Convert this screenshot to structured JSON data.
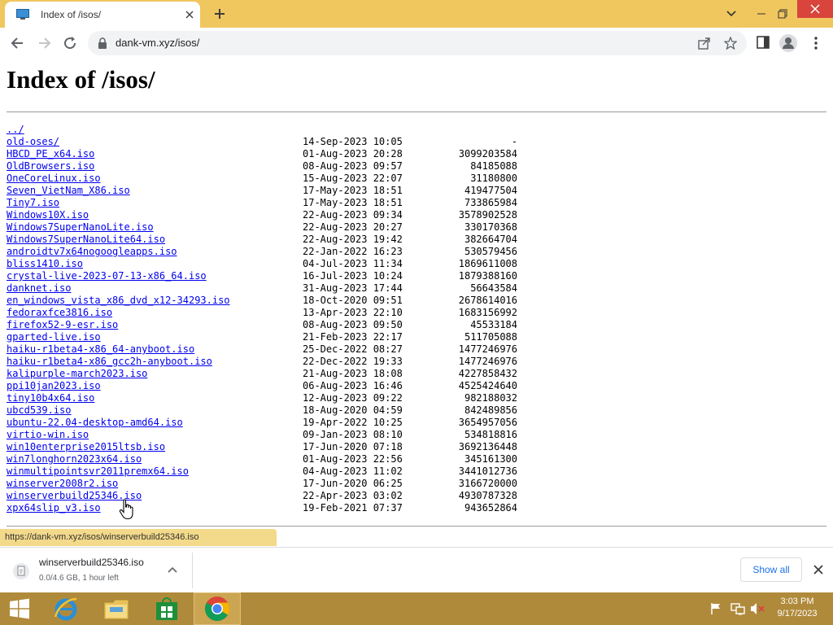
{
  "browser": {
    "tab_title": "Index of /isos/",
    "url": "dank-vm.xyz/isos/",
    "status_url": "https://dank-vm.xyz/isos/winserverbuild25346.iso"
  },
  "page": {
    "title": "Index of /isos/",
    "parent_link": "../",
    "entries": [
      {
        "name": "old-oses/",
        "date": "14-Sep-2023 10:05",
        "size": "-"
      },
      {
        "name": "HBCD_PE_x64.iso",
        "date": "01-Aug-2023 20:28",
        "size": "3099203584"
      },
      {
        "name": "OldBrowsers.iso",
        "date": "08-Aug-2023 09:57",
        "size": "84185088"
      },
      {
        "name": "OneCoreLinux.iso",
        "date": "15-Aug-2023 22:07",
        "size": "31180800"
      },
      {
        "name": "Seven_VietNam_X86.iso",
        "date": "17-May-2023 18:51",
        "size": "419477504"
      },
      {
        "name": "Tiny7.iso",
        "date": "17-May-2023 18:51",
        "size": "733865984"
      },
      {
        "name": "Windows10X.iso",
        "date": "22-Aug-2023 09:34",
        "size": "3578902528"
      },
      {
        "name": "Windows7SuperNanoLite.iso",
        "date": "22-Aug-2023 20:27",
        "size": "330170368"
      },
      {
        "name": "Windows7SuperNanoLite64.iso",
        "date": "22-Aug-2023 19:42",
        "size": "382664704"
      },
      {
        "name": "androidtv7x64nogoogleapps.iso",
        "date": "22-Jan-2022 16:23",
        "size": "530579456"
      },
      {
        "name": "bliss1410.iso",
        "date": "04-Jul-2023 11:34",
        "size": "1869611008"
      },
      {
        "name": "crystal-live-2023-07-13-x86_64.iso",
        "date": "16-Jul-2023 10:24",
        "size": "1879388160"
      },
      {
        "name": "danknet.iso",
        "date": "31-Aug-2023 17:44",
        "size": "56643584"
      },
      {
        "name": "en_windows_vista_x86_dvd_x12-34293.iso",
        "date": "18-Oct-2020 09:51",
        "size": "2678614016"
      },
      {
        "name": "fedoraxfce3816.iso",
        "date": "13-Apr-2023 22:10",
        "size": "1683156992"
      },
      {
        "name": "firefox52-9-esr.iso",
        "date": "08-Aug-2023 09:50",
        "size": "45533184"
      },
      {
        "name": "gparted-live.iso",
        "date": "21-Feb-2023 22:17",
        "size": "511705088"
      },
      {
        "name": "haiku-r1beta4-x86_64-anyboot.iso",
        "date": "25-Dec-2022 08:27",
        "size": "1477246976"
      },
      {
        "name": "haiku-r1beta4-x86_gcc2h-anyboot.iso",
        "date": "22-Dec-2022 19:33",
        "size": "1477246976"
      },
      {
        "name": "kalipurple-march2023.iso",
        "date": "21-Aug-2023 18:08",
        "size": "4227858432"
      },
      {
        "name": "ppi10jan2023.iso",
        "date": "06-Aug-2023 16:46",
        "size": "4525424640"
      },
      {
        "name": "tiny10b4x64.iso",
        "date": "12-Aug-2023 09:22",
        "size": "982188032"
      },
      {
        "name": "ubcd539.iso",
        "date": "18-Aug-2020 04:59",
        "size": "842489856"
      },
      {
        "name": "ubuntu-22.04-desktop-amd64.iso",
        "date": "19-Apr-2022 10:25",
        "size": "3654957056"
      },
      {
        "name": "virtio-win.iso",
        "date": "09-Jan-2023 08:10",
        "size": "534818816"
      },
      {
        "name": "win10enterprise2015ltsb.iso",
        "date": "17-Jun-2020 07:18",
        "size": "3692136448"
      },
      {
        "name": "win7longhorn2023x64.iso",
        "date": "01-Aug-2023 22:56",
        "size": "345161300"
      },
      {
        "name": "winmultipointsvr2011premx64.iso",
        "date": "04-Aug-2023 11:02",
        "size": "3441012736"
      },
      {
        "name": "winserver2008r2.iso",
        "date": "17-Jun-2020 06:25",
        "size": "3166720000"
      },
      {
        "name": "winserverbuild25346.iso",
        "date": "22-Apr-2023 03:02",
        "size": "4930787328"
      },
      {
        "name": "xpx64slip_v3.iso",
        "date": "19-Feb-2021 07:37",
        "size": "943652864"
      }
    ]
  },
  "download": {
    "filename": "winserverbuild25346.iso",
    "status": "0.0/4.6 GB, 1 hour left",
    "show_all_label": "Show all"
  },
  "taskbar": {
    "time": "3:03 PM",
    "date": "9/17/2023"
  },
  "colors": {
    "titlebar": "#f0c65f",
    "taskbar": "#b08a3b",
    "link": "#0000ee",
    "accent": "#1a73e8"
  },
  "icons": [
    "favicon-icon",
    "close-icon",
    "plus-icon",
    "chevron-down-icon",
    "minimize-icon",
    "maximize-icon",
    "back-icon",
    "forward-icon",
    "reload-icon",
    "lock-icon",
    "share-icon",
    "star-icon",
    "side-panel-icon",
    "profile-icon",
    "menu-icon",
    "file-icon",
    "chevron-up-icon",
    "windows-start-icon",
    "ie-icon",
    "file-explorer-icon",
    "store-icon",
    "chrome-icon",
    "flag-icon",
    "network-icon",
    "volume-muted-icon"
  ]
}
